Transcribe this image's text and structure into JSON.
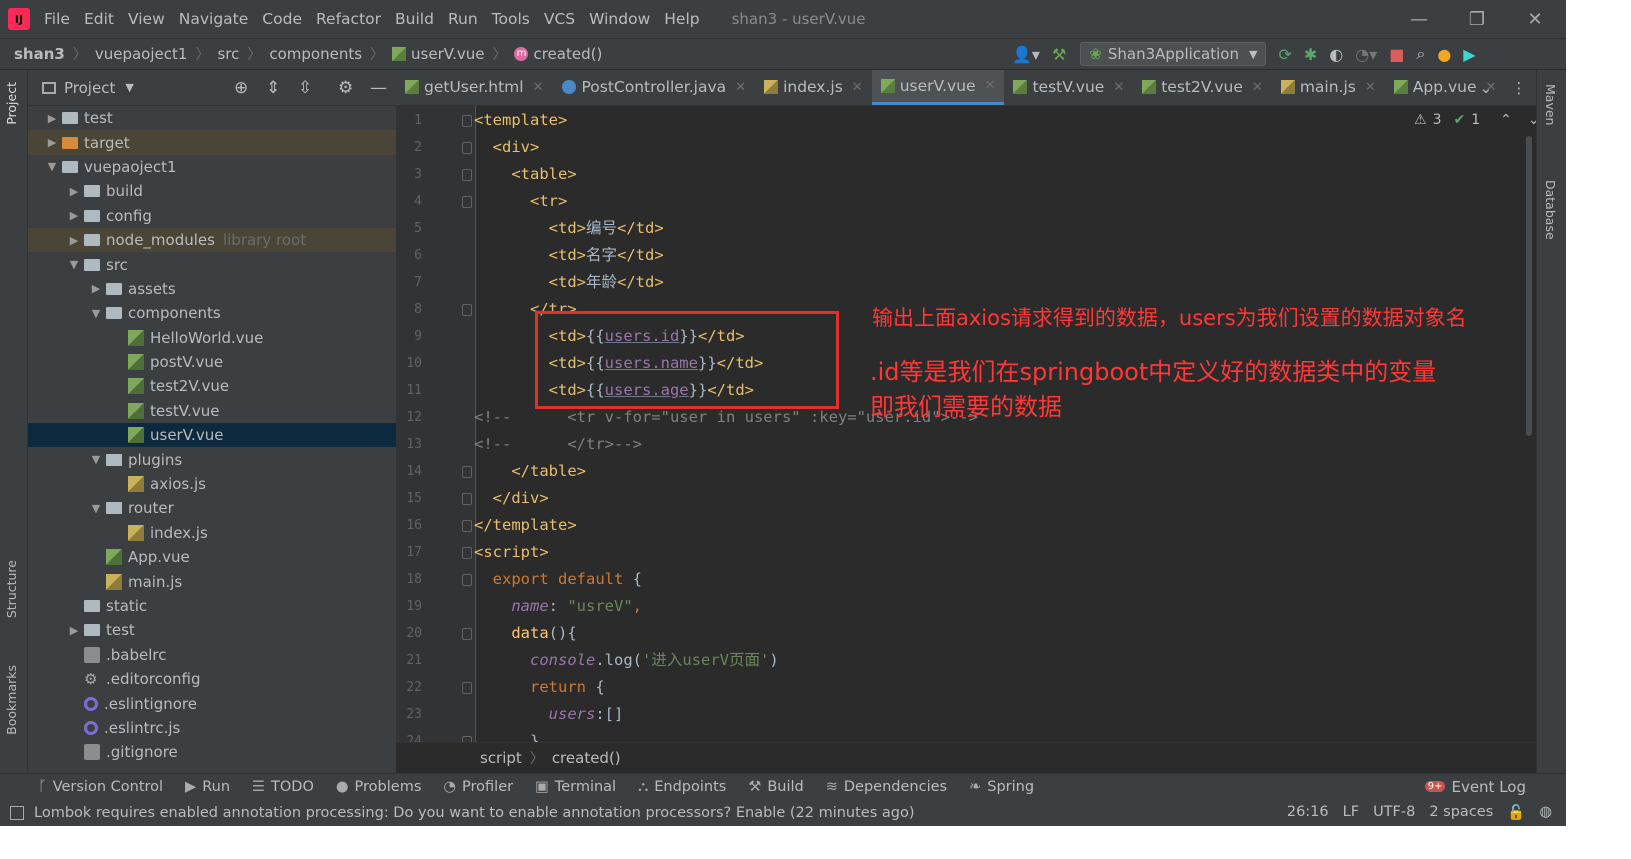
{
  "menubar": {
    "items": [
      "File",
      "Edit",
      "View",
      "Navigate",
      "Code",
      "Refactor",
      "Build",
      "Run",
      "Tools",
      "VCS",
      "Window",
      "Help"
    ],
    "window_title": "shan3 - userV.vue"
  },
  "navbar": {
    "breadcrumbs": [
      "shan3",
      "vuepaoject1",
      "src",
      "components",
      "userV.vue",
      "created()"
    ],
    "run_config": "Shan3Application"
  },
  "left_strip": {
    "project": "Project",
    "structure": "Structure",
    "bookmarks": "Bookmarks"
  },
  "right_strip": {
    "maven": "Maven",
    "database": "Database"
  },
  "project_panel": {
    "title": "Project",
    "tree": [
      {
        "label": "test",
        "depth": 1,
        "arrow": "›",
        "icon": "folder"
      },
      {
        "label": "target",
        "depth": 1,
        "arrow": "›",
        "icon": "folder-orange",
        "state": "excluded"
      },
      {
        "label": "vuepaoject1",
        "depth": 1,
        "arrow": "⌄",
        "icon": "folder"
      },
      {
        "label": "build",
        "depth": 2,
        "arrow": "›",
        "icon": "folder"
      },
      {
        "label": "config",
        "depth": 2,
        "arrow": "›",
        "icon": "folder"
      },
      {
        "label": "node_modules",
        "depth": 2,
        "arrow": "›",
        "icon": "folder",
        "hint": "library root",
        "state": "excluded"
      },
      {
        "label": "src",
        "depth": 2,
        "arrow": "⌄",
        "icon": "folder"
      },
      {
        "label": "assets",
        "depth": 3,
        "arrow": "›",
        "icon": "folder"
      },
      {
        "label": "components",
        "depth": 3,
        "arrow": "⌄",
        "icon": "folder"
      },
      {
        "label": "HelloWorld.vue",
        "depth": 4,
        "arrow": "",
        "icon": "vue"
      },
      {
        "label": "postV.vue",
        "depth": 4,
        "arrow": "",
        "icon": "vue"
      },
      {
        "label": "test2V.vue",
        "depth": 4,
        "arrow": "",
        "icon": "vue"
      },
      {
        "label": "testV.vue",
        "depth": 4,
        "arrow": "",
        "icon": "vue"
      },
      {
        "label": "userV.vue",
        "depth": 4,
        "arrow": "",
        "icon": "vue",
        "state": "selected"
      },
      {
        "label": "plugins",
        "depth": 3,
        "arrow": "⌄",
        "icon": "folder"
      },
      {
        "label": "axios.js",
        "depth": 4,
        "arrow": "",
        "icon": "js"
      },
      {
        "label": "router",
        "depth": 3,
        "arrow": "⌄",
        "icon": "folder"
      },
      {
        "label": "index.js",
        "depth": 4,
        "arrow": "",
        "icon": "js"
      },
      {
        "label": "App.vue",
        "depth": 3,
        "arrow": "",
        "icon": "vue"
      },
      {
        "label": "main.js",
        "depth": 3,
        "arrow": "",
        "icon": "js"
      },
      {
        "label": "static",
        "depth": 2,
        "arrow": "",
        "icon": "folder"
      },
      {
        "label": "test",
        "depth": 2,
        "arrow": "›",
        "icon": "folder"
      },
      {
        "label": ".babelrc",
        "depth": 2,
        "arrow": "",
        "icon": "config"
      },
      {
        "label": ".editorconfig",
        "depth": 2,
        "arrow": "",
        "icon": "gear"
      },
      {
        "label": ".eslintignore",
        "depth": 2,
        "arrow": "",
        "icon": "eslint"
      },
      {
        "label": ".eslintrc.js",
        "depth": 2,
        "arrow": "",
        "icon": "eslint"
      },
      {
        "label": ".gitignore",
        "depth": 2,
        "arrow": "",
        "icon": "config"
      }
    ]
  },
  "editor_tabs": [
    {
      "label": "getUser.html",
      "icon": "html"
    },
    {
      "label": "PostController.java",
      "icon": "class"
    },
    {
      "label": "index.js",
      "icon": "js"
    },
    {
      "label": "userV.vue",
      "icon": "vue",
      "active": true
    },
    {
      "label": "testV.vue",
      "icon": "vue"
    },
    {
      "label": "test2V.vue",
      "icon": "vue"
    },
    {
      "label": "main.js",
      "icon": "js"
    },
    {
      "label": "App.vue",
      "icon": "vue"
    }
  ],
  "inspections": {
    "warnings": "3",
    "ok": "1"
  },
  "code_lines": [
    [
      [
        "tg",
        "<template>"
      ]
    ],
    [
      [
        "",
        "  "
      ],
      [
        "tg",
        "<div>"
      ]
    ],
    [
      [
        "",
        "    "
      ],
      [
        "tg",
        "<table>"
      ]
    ],
    [
      [
        "",
        "      "
      ],
      [
        "tg",
        "<tr>"
      ]
    ],
    [
      [
        "",
        "        "
      ],
      [
        "tg",
        "<td>"
      ],
      [
        "",
        "编号"
      ],
      [
        "tg",
        "</td>"
      ]
    ],
    [
      [
        "",
        "        "
      ],
      [
        "tg",
        "<td>"
      ],
      [
        "",
        "名字"
      ],
      [
        "tg",
        "</td>"
      ]
    ],
    [
      [
        "",
        "        "
      ],
      [
        "tg",
        "<td>"
      ],
      [
        "",
        "年龄"
      ],
      [
        "tg",
        "</td>"
      ]
    ],
    [
      [
        "",
        "      "
      ],
      [
        "tg",
        "</tr>"
      ]
    ],
    [
      [
        "",
        "        "
      ],
      [
        "tg",
        "<td>"
      ],
      [
        "",
        "{{"
      ],
      [
        "var",
        "users.id"
      ],
      [
        "",
        "}}"
      ],
      [
        "tg",
        "</td>"
      ]
    ],
    [
      [
        "",
        "        "
      ],
      [
        "tg",
        "<td>"
      ],
      [
        "",
        "{{"
      ],
      [
        "var",
        "users.name"
      ],
      [
        "",
        "}}"
      ],
      [
        "tg",
        "</td>"
      ]
    ],
    [
      [
        "",
        "        "
      ],
      [
        "tg",
        "<td>"
      ],
      [
        "",
        "{{"
      ],
      [
        "var",
        "users.age"
      ],
      [
        "",
        "}}"
      ],
      [
        "tg",
        "</td>"
      ]
    ],
    [
      [
        "cm",
        "<!--      <tr v-for=\"user in users\" :key=\"user.id\">-->"
      ]
    ],
    [
      [
        "cm",
        "<!--      </tr>-->"
      ]
    ],
    [
      [
        "",
        "    "
      ],
      [
        "tg",
        "</table>"
      ]
    ],
    [
      [
        "",
        "  "
      ],
      [
        "tg",
        "</div>"
      ]
    ],
    [
      [
        "tg",
        "</template>"
      ]
    ],
    [
      [
        "tg",
        "<script>"
      ]
    ],
    [
      [
        "",
        "  "
      ],
      [
        "kw",
        "export default"
      ],
      [
        "",
        " {"
      ]
    ],
    [
      [
        "",
        "    "
      ],
      [
        "it",
        "name"
      ],
      [
        "",
        ": "
      ],
      [
        "str",
        "\"usreV\""
      ],
      [
        "kw",
        ","
      ]
    ],
    [
      [
        "",
        "    "
      ],
      [
        "fn",
        "data"
      ],
      [
        "",
        "(){"
      ]
    ],
    [
      [
        "",
        "      "
      ],
      [
        "it",
        "console"
      ],
      [
        "",
        ".log("
      ],
      [
        "str",
        "'进入userV页面'"
      ],
      [
        "",
        ")"
      ]
    ],
    [
      [
        "",
        "      "
      ],
      [
        "kw",
        "return"
      ],
      [
        "",
        " {"
      ]
    ],
    [
      [
        "",
        "        "
      ],
      [
        "it",
        "users"
      ],
      [
        "",
        ":[]"
      ]
    ],
    [
      [
        "",
        "      }"
      ]
    ]
  ],
  "annotation": {
    "line1": "输出上面axios请求得到的数据，users为我们设置的数据对象名",
    "line2": ".id等是我们在springboot中定义好的数据类中的变量",
    "line3": "即我们需要的数据"
  },
  "editor_breadcrumb": [
    "script",
    "created()"
  ],
  "tool_windows": [
    {
      "label": "Version Control",
      "icon": "branch-icon"
    },
    {
      "label": "Run",
      "icon": "play-icon"
    },
    {
      "label": "TODO",
      "icon": "list-icon"
    },
    {
      "label": "Problems",
      "icon": "info-icon"
    },
    {
      "label": "Profiler",
      "icon": "profiler-icon"
    },
    {
      "label": "Terminal",
      "icon": "terminal-icon"
    },
    {
      "label": "Endpoints",
      "icon": "endpoints-icon"
    },
    {
      "label": "Build",
      "icon": "hammer-icon"
    },
    {
      "label": "Dependencies",
      "icon": "layers-icon"
    },
    {
      "label": "Spring",
      "icon": "leaf-icon"
    }
  ],
  "event_log": {
    "label": "Event Log",
    "badge": "9+"
  },
  "status": {
    "message": "Lombok requires enabled annotation processing: Do you want to enable annotation processors? Enable (22 minutes ago)",
    "position": "26:16",
    "line_sep": "LF",
    "encoding": "UTF-8",
    "indent": "2 spaces"
  },
  "colors": {
    "accent": "#4a88c7",
    "annotation_red": "#e03030"
  }
}
